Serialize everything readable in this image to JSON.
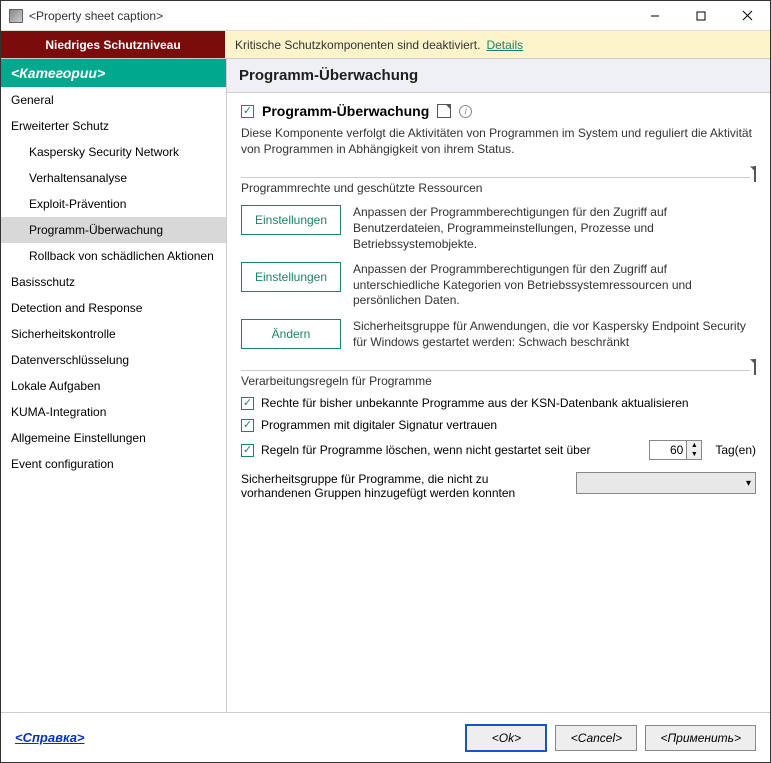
{
  "window": {
    "title": "<Property sheet caption>"
  },
  "alert": {
    "badge": "Niedriges Schutzniveau",
    "text": "Kritische Schutzkomponenten sind deaktiviert.",
    "link": "Details"
  },
  "sidebar": {
    "header": "<Категории>",
    "items": [
      {
        "label": "General",
        "sub": false
      },
      {
        "label": "Erweiterter Schutz",
        "sub": false
      },
      {
        "label": "Kaspersky Security Network",
        "sub": true
      },
      {
        "label": "Verhaltensanalyse",
        "sub": true
      },
      {
        "label": "Exploit-Prävention",
        "sub": true
      },
      {
        "label": "Programm-Überwachung",
        "sub": true,
        "active": true
      },
      {
        "label": "Rollback von schädlichen Aktionen",
        "sub": true
      },
      {
        "label": "Basisschutz",
        "sub": false
      },
      {
        "label": "Detection and Response",
        "sub": false
      },
      {
        "label": "Sicherheitskontrolle",
        "sub": false
      },
      {
        "label": "Datenverschlüsselung",
        "sub": false
      },
      {
        "label": "Lokale Aufgaben",
        "sub": false
      },
      {
        "label": "KUMA-Integration",
        "sub": false
      },
      {
        "label": "Allgemeine Einstellungen",
        "sub": false
      },
      {
        "label": "Event configuration",
        "sub": false
      }
    ]
  },
  "content": {
    "header": "Programm-Überwachung",
    "enable_label": "Programm-Überwachung",
    "description": "Diese Komponente verfolgt die Aktivitäten von Programmen im System und reguliert die Aktivität von Programmen in Abhängigkeit von ihrem Status.",
    "group1": {
      "title": "Programmrechte und geschützte Ressourcen",
      "rows": [
        {
          "btn": "Einstellungen",
          "text": "Anpassen der Programmberechtigungen für den Zugriff auf Benutzerdateien, Programmeinstellungen, Prozesse und Betriebssystemobjekte."
        },
        {
          "btn": "Einstellungen",
          "text": "Anpassen der Programmberechtigungen für den Zugriff auf unterschiedliche Kategorien von Betriebssystemressourcen und persönlichen Daten."
        },
        {
          "btn": "Ändern",
          "text": "Sicherheitsgruppe für Anwendungen, die vor Kaspersky Endpoint Security für Windows gestartet werden: Schwach beschränkt"
        }
      ]
    },
    "group2": {
      "title": "Verarbeitungsregeln für Programme",
      "checks": [
        "Rechte für bisher unbekannte Programme aus der KSN-Datenbank aktualisieren",
        "Programmen mit digitaler Signatur vertrauen",
        "Regeln für Programme löschen, wenn nicht gestartet seit über"
      ],
      "days_value": "60",
      "days_unit": "Tag(en)",
      "select_label": "Sicherheitsgruppe für Programme, die nicht zu vorhandenen Gruppen hinzugefügt werden konnten"
    }
  },
  "footer": {
    "help": "<Справка>",
    "ok": "<Ok>",
    "cancel": "<Cancel>",
    "apply": "<Применить>"
  },
  "edge": {
    "n": "N",
    "vi": "vi"
  }
}
